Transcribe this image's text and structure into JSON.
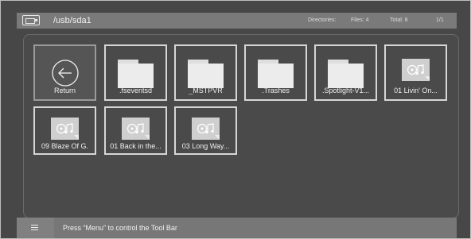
{
  "header": {
    "path": "/usb/sda1",
    "directories_label": "Directories:",
    "files_label": "Files: 4",
    "total_label": "Total: 8",
    "page": "1/1"
  },
  "items": [
    {
      "label": "Return",
      "kind": "return",
      "icon": "return-arrow-icon"
    },
    {
      "label": ".fseventsd",
      "kind": "folder",
      "icon": "folder-icon"
    },
    {
      "label": "_MSTPVR",
      "kind": "folder",
      "icon": "folder-icon"
    },
    {
      "label": ".Trashes",
      "kind": "folder",
      "icon": "folder-icon"
    },
    {
      "label": ".Spotlight-V1...",
      "kind": "folder",
      "icon": "folder-icon"
    },
    {
      "label": "01 Livin' On...",
      "kind": "music",
      "icon": "music-file-icon"
    },
    {
      "label": "09 Blaze Of G.",
      "kind": "music",
      "icon": "music-file-icon"
    },
    {
      "label": "01 Back in the...",
      "kind": "music",
      "icon": "music-file-icon"
    },
    {
      "label": "03 Long Way...",
      "kind": "music",
      "icon": "music-file-icon"
    }
  ],
  "footer": {
    "hint": "Press “Menu” to control the Tool Bar"
  }
}
